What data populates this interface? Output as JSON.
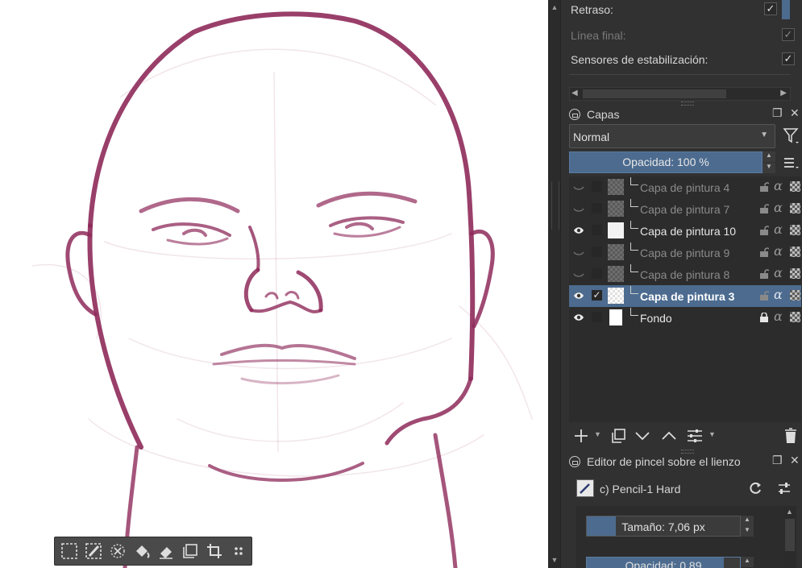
{
  "brush_options": {
    "rows": [
      {
        "label": "Retraso:",
        "checked": true,
        "enabled": true
      },
      {
        "label": "Línea final:",
        "checked": true,
        "enabled": false
      },
      {
        "label": "Sensores de estabilización:",
        "checked": true,
        "enabled": true
      }
    ]
  },
  "layers_panel": {
    "title": "Capas",
    "blend_mode": "Normal",
    "opacity_label": "Opacidad: 100 %",
    "layers": [
      {
        "name": "Capa de pintura 4",
        "visible": false,
        "selected": false,
        "active": false,
        "icon": "paint-layer-icon"
      },
      {
        "name": "Capa de pintura 7",
        "visible": false,
        "selected": false,
        "active": false,
        "icon": "paint-layer-icon"
      },
      {
        "name": "Capa de pintura 10",
        "visible": true,
        "selected": false,
        "active": false,
        "icon": "paint-layer-icon"
      },
      {
        "name": "Capa de pintura 9",
        "visible": false,
        "selected": false,
        "active": false,
        "icon": "paint-layer-icon"
      },
      {
        "name": "Capa de pintura 8",
        "visible": false,
        "selected": false,
        "active": false,
        "icon": "paint-layer-icon"
      },
      {
        "name": "Capa de pintura 3",
        "visible": true,
        "selected": true,
        "active": true,
        "icon": "paint-layer-icon"
      },
      {
        "name": "Fondo",
        "visible": true,
        "selected": false,
        "active": false,
        "icon": "paint-layer-icon",
        "locked": true
      }
    ]
  },
  "brush_editor": {
    "title": "Editor de pincel sobre el lienzo",
    "preset_name": "c) Pencil-1 Hard",
    "size_label": "Tamaño: 7,06 px",
    "opacity_label": "Opacidad: 0,89"
  },
  "colors": {
    "panel_bg": "#313131",
    "accent": "#4c6b8f",
    "stroke": "#8e2a5a"
  },
  "icons": {
    "toolbar": [
      "select-all-icon",
      "deselect-icon",
      "clear-selection-icon",
      "fill-icon",
      "eraser-icon",
      "copy-layer-icon",
      "crop-icon",
      "drag-handle-icon"
    ],
    "layer_tools": [
      "add-layer-icon",
      "duplicate-layer-icon",
      "move-down-icon",
      "move-up-icon",
      "layer-properties-icon",
      "delete-layer-icon"
    ]
  }
}
